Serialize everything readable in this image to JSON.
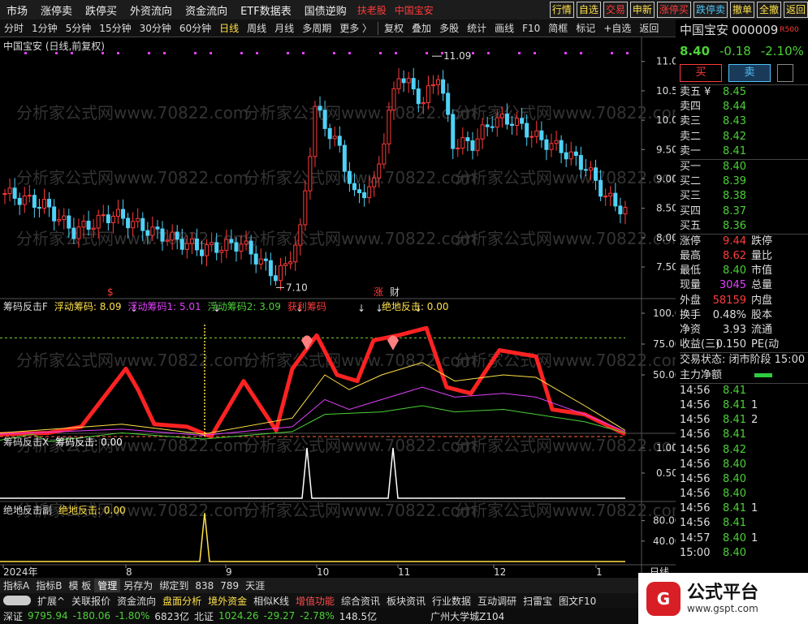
{
  "menubar": {
    "items": [
      "市场",
      "涨停卖",
      "跌停买",
      "外资流向",
      "资金流向",
      "ETF数据表",
      "国债逆购"
    ],
    "stock_link": "扶老股",
    "stock_name": "中国宝安",
    "right": [
      "行情",
      "自选",
      "交易",
      "申新",
      "涨停买",
      "跌停卖",
      "撤单",
      "全撤",
      "返回"
    ]
  },
  "toolbar": {
    "periods": [
      "分时",
      "1分钟",
      "5分钟",
      "15分钟",
      "30分钟",
      "60分钟",
      "日线",
      "周线",
      "月线",
      "多周期",
      "更多 〉"
    ],
    "active": "日线",
    "tools": [
      "复权",
      "叠加",
      "多股",
      "统计",
      "画线",
      "F10",
      "简框",
      "标记",
      "+自选",
      "返回"
    ]
  },
  "main_chart": {
    "title": "中国宝安 (日线,前复权)",
    "y_ticks": [
      "11.00",
      "10.50",
      "10.00",
      "9.50",
      "9.00",
      "8.50",
      "8.00",
      "7.50"
    ],
    "high_label": "11.09",
    "low_label": "7.10",
    "markers": [
      "$",
      "涨",
      "财"
    ]
  },
  "ind1": {
    "title": "筹码反击F",
    "labels": [
      {
        "t": "浮动筹码: 8.09",
        "c": "#ffe14a"
      },
      {
        "t": "浮动筹码1: 5.01",
        "c": "#e040fb"
      },
      {
        "t": "浮动筹码2: 3.09",
        "c": "#4cd137"
      },
      {
        "t": "获利筹码",
        "c": "#ff3b3b"
      },
      {
        "t": "绝地反击: 0.00",
        "c": "#ffe14a"
      }
    ],
    "y_ticks": [
      "100.0",
      "75.00",
      "50.00"
    ]
  },
  "ind2": {
    "title": "筹码反击X",
    "label": "筹码反击: 0.00",
    "y_ticks": [
      "1.00",
      "0.50"
    ]
  },
  "ind3": {
    "title": "绝地反击副",
    "label": "绝地反击: 0.00",
    "y_ticks": [
      "80.00",
      "40.00"
    ]
  },
  "x_axis": {
    "labels": [
      "2024年",
      "8",
      "9",
      "10",
      "11",
      "12",
      "1"
    ],
    "cycle": "日线"
  },
  "watermark": "分析家公式网www.70822.com",
  "watermark2": "www.gsptt.com",
  "quote": {
    "name": "中国宝安",
    "code": "000009",
    "badge": "R500",
    "price": "8.40",
    "change": "-0.18",
    "pct": "-2.10%",
    "buy_btn": "买",
    "sell_btn": "卖",
    "asks": [
      {
        "l": "卖五 ¥",
        "p": "8.45",
        "v": ""
      },
      {
        "l": "卖四",
        "p": "8.44",
        "v": ""
      },
      {
        "l": "卖三",
        "p": "8.43",
        "v": ""
      },
      {
        "l": "卖二",
        "p": "8.42",
        "v": ""
      },
      {
        "l": "卖一",
        "p": "8.41",
        "v": ""
      }
    ],
    "bids": [
      {
        "l": "买一",
        "p": "8.40",
        "v": ""
      },
      {
        "l": "买二",
        "p": "8.39",
        "v": ""
      },
      {
        "l": "买三",
        "p": "8.38",
        "v": ""
      },
      {
        "l": "买四",
        "p": "8.37",
        "v": ""
      },
      {
        "l": "买五",
        "p": "8.36",
        "v": ""
      }
    ],
    "stats": [
      {
        "l": "涨停",
        "v": "9.44",
        "c": "#ff3b3b",
        "s": "跌停"
      },
      {
        "l": "最高",
        "v": "8.62",
        "c": "#ff3b3b",
        "s": "量比"
      },
      {
        "l": "最低",
        "v": "8.40",
        "c": "#4cd137",
        "s": "市值"
      },
      {
        "l": "现量",
        "v": "3045",
        "c": "#e040fb",
        "s": "总量"
      },
      {
        "l": "外盘",
        "v": "58159",
        "c": "#ff3b3b",
        "s": "内盘"
      },
      {
        "l": "换手",
        "v": "0.48%",
        "c": "#ddd",
        "s": "股本"
      },
      {
        "l": "净资",
        "v": "3.93",
        "c": "#ddd",
        "s": "流通"
      },
      {
        "l": "收益(三)",
        "v": "0.150",
        "c": "#ddd",
        "s": "PE(动"
      }
    ],
    "trade_state": "交易状态: 闭市阶段 15:00",
    "net_flow": "主力净额",
    "ticks": [
      {
        "t": "14:56",
        "p": "8.41",
        "v": ""
      },
      {
        "t": "14:56",
        "p": "8.41",
        "v": "1"
      },
      {
        "t": "14:56",
        "p": "8.41",
        "v": "2"
      },
      {
        "t": "14:56",
        "p": "8.41",
        "v": ""
      },
      {
        "t": "14:56",
        "p": "8.42",
        "v": ""
      },
      {
        "t": "14:56",
        "p": "8.40",
        "v": ""
      },
      {
        "t": "14:56",
        "p": "8.40",
        "v": ""
      },
      {
        "t": "14:56",
        "p": "8.40",
        "v": ""
      },
      {
        "t": "14:56",
        "p": "8.41",
        "v": "1"
      },
      {
        "t": "14:56",
        "p": "8.41",
        "v": ""
      },
      {
        "t": "14:57",
        "p": "8.40",
        "v": "1"
      },
      {
        "t": "15:00",
        "p": "8.40",
        "v": ""
      }
    ]
  },
  "bottom_tabs": [
    "指标A",
    "指标B",
    "模 板",
    "管理",
    "另存为",
    "绑定到",
    "838",
    "789",
    "天涯"
  ],
  "bottom_tabs2": [
    {
      "t": "扩展^",
      "c": ""
    },
    {
      "t": "关联报价",
      "c": ""
    },
    {
      "t": "资金流向",
      "c": ""
    },
    {
      "t": "盘面分析",
      "c": "y"
    },
    {
      "t": "境外资金",
      "c": "y"
    },
    {
      "t": "相似K线",
      "c": ""
    },
    {
      "t": "增值功能",
      "c": "r"
    },
    {
      "t": "综合资讯",
      "c": ""
    },
    {
      "t": "板块资讯",
      "c": ""
    },
    {
      "t": "行业数据",
      "c": ""
    },
    {
      "t": "互动调研",
      "c": ""
    },
    {
      "t": "扫雷宝",
      "c": ""
    },
    {
      "t": "图文F10",
      "c": ""
    }
  ],
  "statusbar": {
    "a": "深证",
    "b": "9795.94",
    "c": "-180.06",
    "d": "-1.80%",
    "e": "6823亿",
    "f": "北证",
    "g": "1024.26",
    "h": "-29.27",
    "i": "-2.78%",
    "j": "148.5亿",
    "k": "广州大学城Z104"
  },
  "logo": {
    "icon": "G",
    "name": "公式平台",
    "url": "www.gspt.com"
  },
  "chart_data": {
    "type": "candlestick",
    "series": [
      {
        "name": "浮动筹码",
        "values": [
          8.09
        ]
      },
      {
        "name": "浮动筹码1",
        "values": [
          5.01
        ]
      },
      {
        "name": "浮动筹码2",
        "values": [
          3.09
        ]
      }
    ],
    "high": 11.09,
    "low": 7.1,
    "ylim": [
      7.1,
      11.3
    ]
  }
}
